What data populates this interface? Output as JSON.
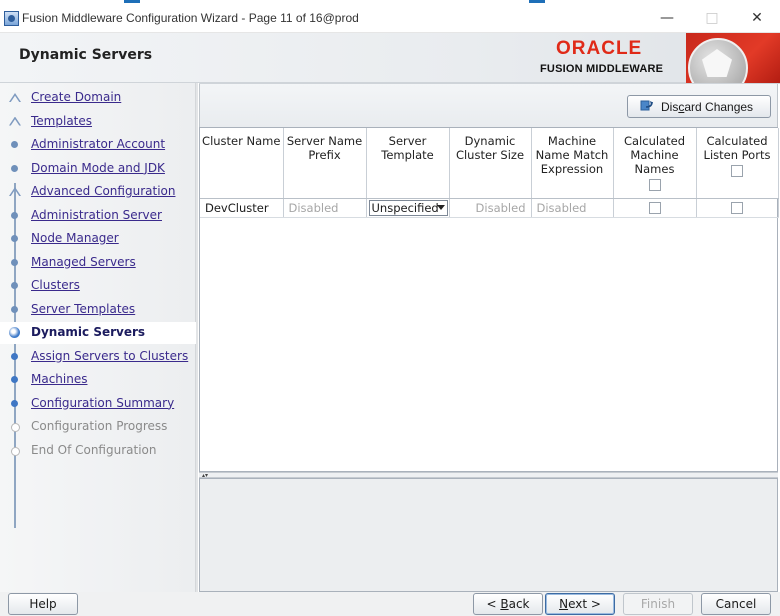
{
  "window": {
    "title": "Fusion Middleware Configuration Wizard - Page 11 of 16@prod",
    "minimize_glyph": "—",
    "maximize_glyph": "□",
    "close_glyph": "✕"
  },
  "header": {
    "page_title": "Dynamic Servers",
    "brand_name": "ORACLE",
    "brand_sub": "FUSION MIDDLEWARE",
    "brand_color": "#e02a18"
  },
  "sidebar": {
    "items": [
      {
        "label": "Create Domain",
        "state": "done",
        "icon": "tree"
      },
      {
        "label": "Templates",
        "state": "done",
        "icon": "tree"
      },
      {
        "label": "Administrator Account",
        "state": "done",
        "icon": "step"
      },
      {
        "label": "Domain Mode and JDK",
        "state": "done",
        "icon": "step"
      },
      {
        "label": "Advanced Configuration",
        "state": "done",
        "icon": "tree"
      },
      {
        "label": "Administration Server",
        "state": "done",
        "icon": "step"
      },
      {
        "label": "Node Manager",
        "state": "done",
        "icon": "step"
      },
      {
        "label": "Managed Servers",
        "state": "done",
        "icon": "step"
      },
      {
        "label": "Clusters",
        "state": "done",
        "icon": "step"
      },
      {
        "label": "Server Templates",
        "state": "done",
        "icon": "step"
      },
      {
        "label": "Dynamic Servers",
        "state": "current",
        "icon": "current"
      },
      {
        "label": "Assign Servers to Clusters",
        "state": "future",
        "icon": "future"
      },
      {
        "label": "Machines",
        "state": "future",
        "icon": "future"
      },
      {
        "label": "Configuration Summary",
        "state": "future",
        "icon": "future"
      },
      {
        "label": "Configuration Progress",
        "state": "disabled",
        "icon": "gray"
      },
      {
        "label": "End Of Configuration",
        "state": "disabled",
        "icon": "gray"
      }
    ]
  },
  "toolbar": {
    "discard_label_pre": "Dis",
    "discard_label_accel": "c",
    "discard_label_post": "ard Changes"
  },
  "table": {
    "columns": [
      "Cluster Name",
      "Server Name Prefix",
      "Server Template",
      "Dynamic Cluster Size",
      "Machine Name Match Expression",
      "Calculated Machine Names",
      "Calculated Listen Ports"
    ],
    "rows": [
      {
        "cluster_name": "DevCluster",
        "server_name_prefix": "Disabled",
        "server_template": "Unspecified",
        "dynamic_cluster_size": "Disabled",
        "machine_name_match": "Disabled",
        "calculated_machine_names": false,
        "calculated_listen_ports": false
      }
    ],
    "header_checks": {
      "calculated_machine_names": false,
      "calculated_listen_ports": false
    }
  },
  "footer": {
    "help": "Help",
    "back_pre": "< ",
    "back_accel": "B",
    "back_post": "ack",
    "next_accel": "N",
    "next_post": "ext >",
    "finish": "Finish",
    "cancel": "Cancel"
  }
}
